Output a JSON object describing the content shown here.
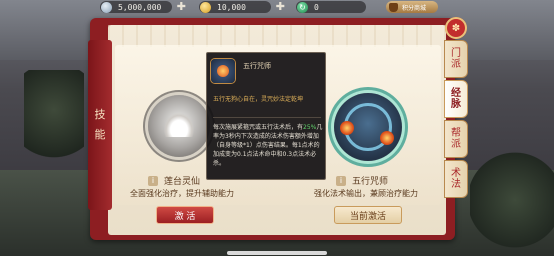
{
  "top_bar": {
    "silver": {
      "icon": "silver-coin-icon",
      "value": "5,000,000"
    },
    "gold": {
      "icon": "gold-coin-icon",
      "value": "10,000"
    },
    "jade": {
      "icon": "jade-icon",
      "value": "0"
    },
    "shop_label": "积分商城"
  },
  "side_title": [
    "技",
    "能"
  ],
  "tabs": [
    {
      "label": [
        "门",
        "派"
      ],
      "active": false
    },
    {
      "label": [
        "经",
        "脉"
      ],
      "active": true
    },
    {
      "label": [
        "帮",
        "派"
      ],
      "active": false
    },
    {
      "label": [
        "术",
        "法"
      ],
      "active": false
    }
  ],
  "tooltip": {
    "name": "五行咒师",
    "flavor": "五行无狗心自在，灵咒妙法定乾坤",
    "body_parts": [
      "每次施展紧箍咒或五行法术后，有",
      "25%",
      "几率为3秒内下次造成的法术伤害额外增加（自身等级*1）点伤害结果。每1点术的加成变为0.1点法术命中和0.3点法术必杀。"
    ]
  },
  "skills": [
    {
      "name": "莲台灵仙",
      "desc": "全面强化治疗，提升辅助能力",
      "button": "激 活"
    },
    {
      "name": "五行咒师",
      "desc": "强化法术输出，兼顾治疗能力",
      "button": "当前激活"
    }
  ],
  "colors": {
    "accent_red": "#8d1e22",
    "paper": "#f3ead9",
    "highlight_green": "#63d46d",
    "flavor_gold": "#e0b25a"
  }
}
